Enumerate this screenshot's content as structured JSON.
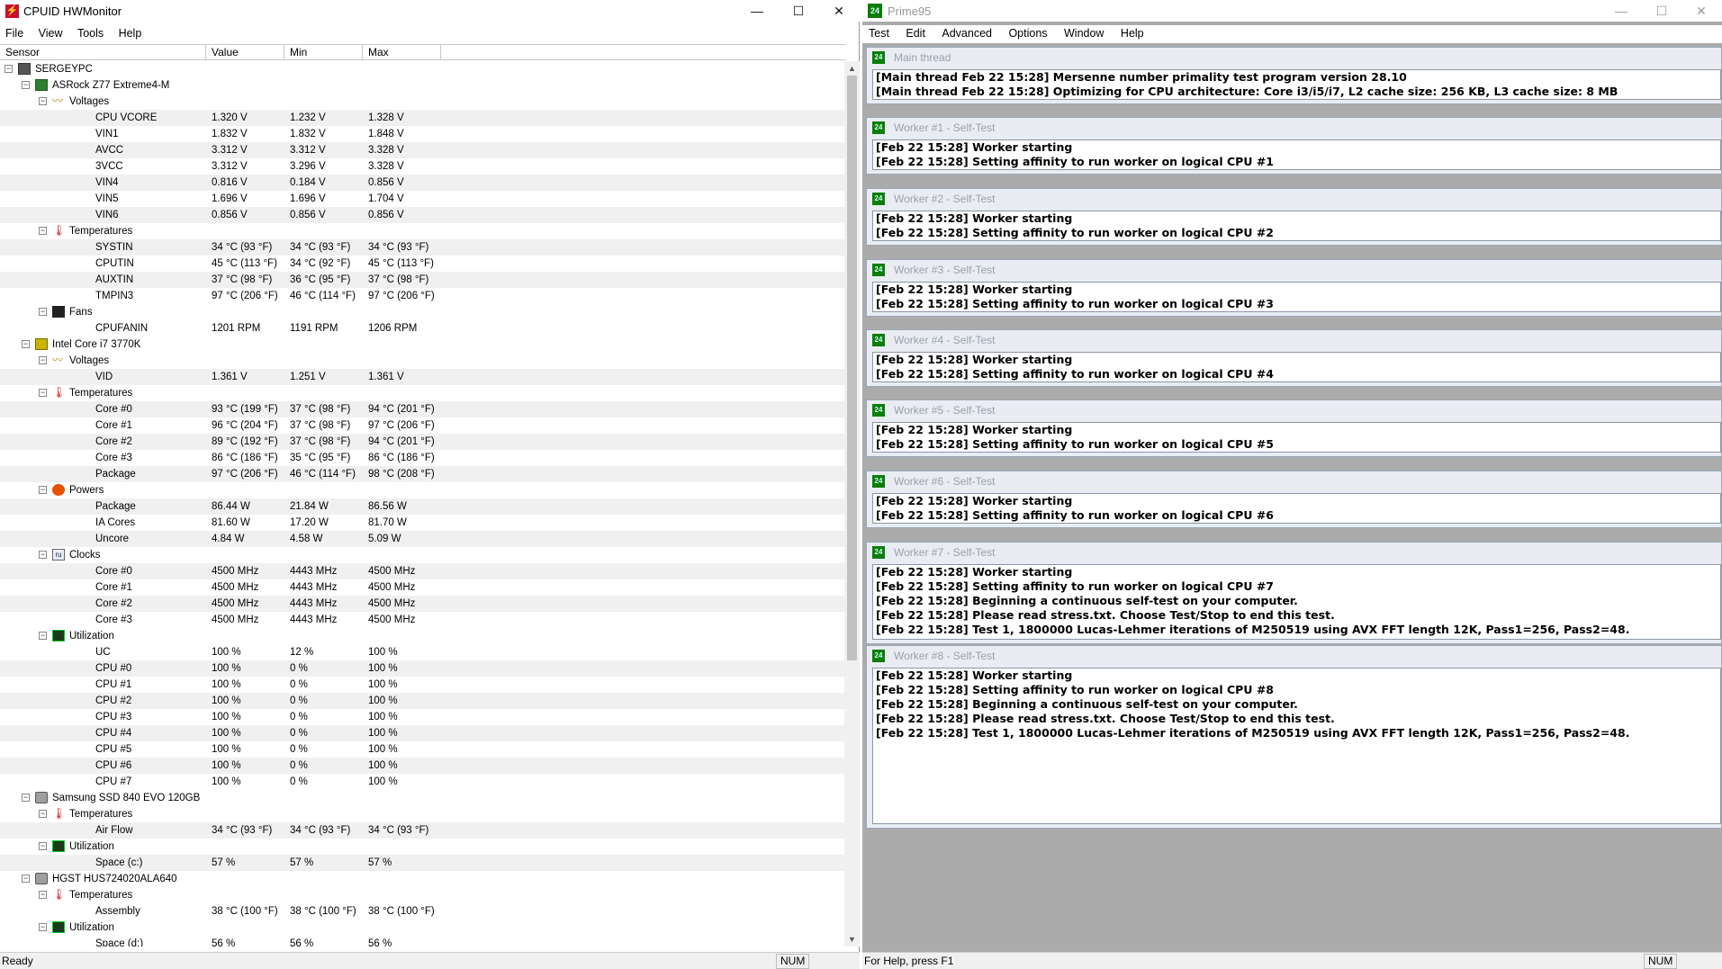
{
  "hwmonitor": {
    "title": "CPUID HWMonitor",
    "controls": {
      "minimize": "—",
      "maximize": "☐",
      "close": "✕"
    },
    "menu": [
      "File",
      "View",
      "Tools",
      "Help"
    ],
    "columns": {
      "sensor": "Sensor",
      "value": "Value",
      "min": "Min",
      "max": "Max"
    },
    "rows": [
      {
        "level": 0,
        "kind": "node",
        "icon": "computer-icon",
        "label": "SERGEYPC"
      },
      {
        "level": 1,
        "kind": "node",
        "icon": "motherboard-icon",
        "label": "ASRock Z77 Extreme4-M"
      },
      {
        "level": 2,
        "kind": "node",
        "icon": "voltage-icon",
        "label": "Voltages"
      },
      {
        "level": 3,
        "kind": "sensor",
        "label": "CPU VCORE",
        "value": "1.320 V",
        "min": "1.232 V",
        "max": "1.328 V"
      },
      {
        "level": 3,
        "kind": "sensor",
        "label": "VIN1",
        "value": "1.832 V",
        "min": "1.832 V",
        "max": "1.848 V"
      },
      {
        "level": 3,
        "kind": "sensor",
        "label": "AVCC",
        "value": "3.312 V",
        "min": "3.312 V",
        "max": "3.328 V"
      },
      {
        "level": 3,
        "kind": "sensor",
        "label": "3VCC",
        "value": "3.312 V",
        "min": "3.296 V",
        "max": "3.328 V"
      },
      {
        "level": 3,
        "kind": "sensor",
        "label": "VIN4",
        "value": "0.816 V",
        "min": "0.184 V",
        "max": "0.856 V"
      },
      {
        "level": 3,
        "kind": "sensor",
        "label": "VIN5",
        "value": "1.696 V",
        "min": "1.696 V",
        "max": "1.704 V"
      },
      {
        "level": 3,
        "kind": "sensor",
        "label": "VIN6",
        "value": "0.856 V",
        "min": "0.856 V",
        "max": "0.856 V"
      },
      {
        "level": 2,
        "kind": "node",
        "icon": "temperature-icon",
        "label": "Temperatures"
      },
      {
        "level": 3,
        "kind": "sensor",
        "label": "SYSTIN",
        "value": "34 °C (93 °F)",
        "min": "34 °C (93 °F)",
        "max": "34 °C (93 °F)"
      },
      {
        "level": 3,
        "kind": "sensor",
        "label": "CPUTIN",
        "value": "45 °C (113 °F)",
        "min": "34 °C (92 °F)",
        "max": "45 °C (113 °F)"
      },
      {
        "level": 3,
        "kind": "sensor",
        "label": "AUXTIN",
        "value": "37 °C (98 °F)",
        "min": "36 °C (95 °F)",
        "max": "37 °C (98 °F)"
      },
      {
        "level": 3,
        "kind": "sensor",
        "label": "TMPIN3",
        "value": "97 °C (206 °F)",
        "min": "46 °C (114 °F)",
        "max": "97 °C (206 °F)"
      },
      {
        "level": 2,
        "kind": "node",
        "icon": "fan-icon",
        "label": "Fans"
      },
      {
        "level": 3,
        "kind": "sensor",
        "label": "CPUFANIN",
        "value": "1201 RPM",
        "min": "1191 RPM",
        "max": "1206 RPM"
      },
      {
        "level": 1,
        "kind": "node",
        "icon": "cpu-icon",
        "label": "Intel Core i7 3770K"
      },
      {
        "level": 2,
        "kind": "node",
        "icon": "voltage-icon",
        "label": "Voltages"
      },
      {
        "level": 3,
        "kind": "sensor",
        "label": "VID",
        "value": "1.361 V",
        "min": "1.251 V",
        "max": "1.361 V"
      },
      {
        "level": 2,
        "kind": "node",
        "icon": "temperature-icon",
        "label": "Temperatures"
      },
      {
        "level": 3,
        "kind": "sensor",
        "label": "Core #0",
        "value": "93 °C (199 °F)",
        "min": "37 °C (98 °F)",
        "max": "94 °C (201 °F)"
      },
      {
        "level": 3,
        "kind": "sensor",
        "label": "Core #1",
        "value": "96 °C (204 °F)",
        "min": "37 °C (98 °F)",
        "max": "97 °C (206 °F)"
      },
      {
        "level": 3,
        "kind": "sensor",
        "label": "Core #2",
        "value": "89 °C (192 °F)",
        "min": "37 °C (98 °F)",
        "max": "94 °C (201 °F)"
      },
      {
        "level": 3,
        "kind": "sensor",
        "label": "Core #3",
        "value": "86 °C (186 °F)",
        "min": "35 °C (95 °F)",
        "max": "86 °C (186 °F)"
      },
      {
        "level": 3,
        "kind": "sensor",
        "label": "Package",
        "value": "97 °C (206 °F)",
        "min": "46 °C (114 °F)",
        "max": "98 °C (208 °F)"
      },
      {
        "level": 2,
        "kind": "node",
        "icon": "power-icon",
        "label": "Powers"
      },
      {
        "level": 3,
        "kind": "sensor",
        "label": "Package",
        "value": "86.44 W",
        "min": "21.84 W",
        "max": "86.56 W"
      },
      {
        "level": 3,
        "kind": "sensor",
        "label": "IA Cores",
        "value": "81.60 W",
        "min": "17.20 W",
        "max": "81.70 W"
      },
      {
        "level": 3,
        "kind": "sensor",
        "label": "Uncore",
        "value": "4.84 W",
        "min": "4.58 W",
        "max": "5.09 W"
      },
      {
        "level": 2,
        "kind": "node",
        "icon": "clock-icon",
        "label": "Clocks"
      },
      {
        "level": 3,
        "kind": "sensor",
        "label": "Core #0",
        "value": "4500 MHz",
        "min": "4443 MHz",
        "max": "4500 MHz"
      },
      {
        "level": 3,
        "kind": "sensor",
        "label": "Core #1",
        "value": "4500 MHz",
        "min": "4443 MHz",
        "max": "4500 MHz"
      },
      {
        "level": 3,
        "kind": "sensor",
        "label": "Core #2",
        "value": "4500 MHz",
        "min": "4443 MHz",
        "max": "4500 MHz"
      },
      {
        "level": 3,
        "kind": "sensor",
        "label": "Core #3",
        "value": "4500 MHz",
        "min": "4443 MHz",
        "max": "4500 MHz"
      },
      {
        "level": 2,
        "kind": "node",
        "icon": "utilization-icon",
        "label": "Utilization"
      },
      {
        "level": 3,
        "kind": "sensor",
        "label": "UC",
        "value": "100 %",
        "min": "12 %",
        "max": "100 %"
      },
      {
        "level": 3,
        "kind": "sensor",
        "label": "CPU #0",
        "value": "100 %",
        "min": "0 %",
        "max": "100 %"
      },
      {
        "level": 3,
        "kind": "sensor",
        "label": "CPU #1",
        "value": "100 %",
        "min": "0 %",
        "max": "100 %"
      },
      {
        "level": 3,
        "kind": "sensor",
        "label": "CPU #2",
        "value": "100 %",
        "min": "0 %",
        "max": "100 %"
      },
      {
        "level": 3,
        "kind": "sensor",
        "label": "CPU #3",
        "value": "100 %",
        "min": "0 %",
        "max": "100 %"
      },
      {
        "level": 3,
        "kind": "sensor",
        "label": "CPU #4",
        "value": "100 %",
        "min": "0 %",
        "max": "100 %"
      },
      {
        "level": 3,
        "kind": "sensor",
        "label": "CPU #5",
        "value": "100 %",
        "min": "0 %",
        "max": "100 %"
      },
      {
        "level": 3,
        "kind": "sensor",
        "label": "CPU #6",
        "value": "100 %",
        "min": "0 %",
        "max": "100 %"
      },
      {
        "level": 3,
        "kind": "sensor",
        "label": "CPU #7",
        "value": "100 %",
        "min": "0 %",
        "max": "100 %"
      },
      {
        "level": 1,
        "kind": "node",
        "icon": "disk-icon",
        "label": "Samsung SSD 840 EVO 120GB"
      },
      {
        "level": 2,
        "kind": "node",
        "icon": "temperature-icon",
        "label": "Temperatures"
      },
      {
        "level": 3,
        "kind": "sensor",
        "label": "Air Flow",
        "value": "34 °C (93 °F)",
        "min": "34 °C (93 °F)",
        "max": "34 °C (93 °F)"
      },
      {
        "level": 2,
        "kind": "node",
        "icon": "utilization-icon",
        "label": "Utilization"
      },
      {
        "level": 3,
        "kind": "sensor",
        "label": "Space (c:)",
        "value": "57 %",
        "min": "57 %",
        "max": "57 %"
      },
      {
        "level": 1,
        "kind": "node",
        "icon": "disk-icon",
        "label": "HGST HUS724020ALA640"
      },
      {
        "level": 2,
        "kind": "node",
        "icon": "temperature-icon",
        "label": "Temperatures"
      },
      {
        "level": 3,
        "kind": "sensor",
        "label": "Assembly",
        "value": "38 °C (100 °F)",
        "min": "38 °C (100 °F)",
        "max": "38 °C (100 °F)"
      },
      {
        "level": 2,
        "kind": "node",
        "icon": "utilization-icon",
        "label": "Utilization"
      },
      {
        "level": 3,
        "kind": "sensor",
        "label": "Space (d:)",
        "value": "56 %",
        "min": "56 %",
        "max": "56 %"
      }
    ],
    "status": {
      "text": "Ready",
      "num": "NUM"
    }
  },
  "prime95": {
    "title": "Prime95",
    "controls": {
      "minimize": "—",
      "maximize": "☐",
      "close": "✕"
    },
    "menu": [
      "Test",
      "Edit",
      "Advanced",
      "Options",
      "Window",
      "Help"
    ],
    "windows": [
      {
        "name": "Main thread",
        "lines": [
          "[Main thread Feb 22 15:28] Mersenne number primality test program version 28.10",
          "[Main thread Feb 22 15:28] Optimizing for CPU architecture: Core i3/i5/i7, L2 cache size: 256 KB, L3 cache size: 8 MB"
        ]
      },
      {
        "name": "Worker #1 - Self-Test",
        "lines": [
          "[Feb 22 15:28] Worker starting",
          "[Feb 22 15:28] Setting affinity to run worker on logical CPU #1"
        ]
      },
      {
        "name": "Worker #2 - Self-Test",
        "lines": [
          "[Feb 22 15:28] Worker starting",
          "[Feb 22 15:28] Setting affinity to run worker on logical CPU #2"
        ]
      },
      {
        "name": "Worker #3 - Self-Test",
        "lines": [
          "[Feb 22 15:28] Worker starting",
          "[Feb 22 15:28] Setting affinity to run worker on logical CPU #3"
        ]
      },
      {
        "name": "Worker #4 - Self-Test",
        "lines": [
          "[Feb 22 15:28] Worker starting",
          "[Feb 22 15:28] Setting affinity to run worker on logical CPU #4"
        ]
      },
      {
        "name": "Worker #5 - Self-Test",
        "lines": [
          "[Feb 22 15:28] Worker starting",
          "[Feb 22 15:28] Setting affinity to run worker on logical CPU #5"
        ]
      },
      {
        "name": "Worker #6 - Self-Test",
        "lines": [
          "[Feb 22 15:28] Worker starting",
          "[Feb 22 15:28] Setting affinity to run worker on logical CPU #6"
        ]
      },
      {
        "name": "Worker #7 - Self-Test",
        "lines": [
          "[Feb 22 15:28] Worker starting",
          "[Feb 22 15:28] Setting affinity to run worker on logical CPU #7",
          "[Feb 22 15:28] Beginning a continuous self-test on your computer.",
          "[Feb 22 15:28] Please read stress.txt.  Choose Test/Stop to end this test.",
          "[Feb 22 15:28] Test 1, 1800000 Lucas-Lehmer iterations of M250519 using AVX FFT length 12K, Pass1=256, Pass2=48."
        ]
      },
      {
        "name": "Worker #8 - Self-Test",
        "lines": [
          "[Feb 22 15:28] Worker starting",
          "[Feb 22 15:28] Setting affinity to run worker on logical CPU #8",
          "[Feb 22 15:28] Beginning a continuous self-test on your computer.",
          "[Feb 22 15:28] Please read stress.txt.  Choose Test/Stop to end this test.",
          "[Feb 22 15:28] Test 1, 1800000 Lucas-Lehmer iterations of M250519 using AVX FFT length 12K, Pass1=256, Pass2=48."
        ]
      }
    ],
    "status": {
      "text": "For Help, press F1",
      "num": "NUM"
    }
  }
}
